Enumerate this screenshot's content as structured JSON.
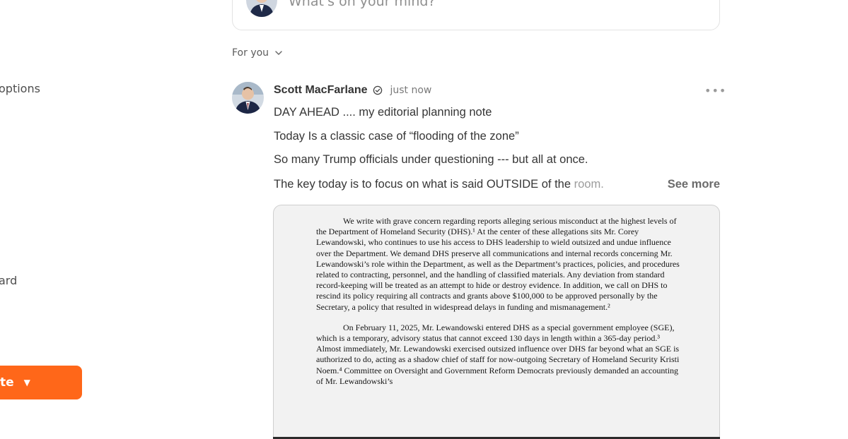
{
  "sidebar": {
    "items": [
      {
        "label": "options"
      },
      {
        "label": "ard"
      }
    ],
    "create_button": {
      "label": "te",
      "icon": "caret-down-icon",
      "color": "#ff6719"
    }
  },
  "composer": {
    "placeholder": "What's on your mind?"
  },
  "feed": {
    "selector_label": "For you",
    "selector_icon": "chevron-down-icon"
  },
  "post": {
    "author": "Scott MacFarlane",
    "verified_icon": "verified-check-icon",
    "timestamp": "just now",
    "menu_icon": "more-horizontal-icon",
    "lines": [
      "DAY AHEAD .... my editorial planning note",
      "Today Is a classic case of “flooding of the zone”",
      "So many Trump officials under questioning --- but all at once."
    ],
    "line4_main": "The key today is to focus on what is said OUTSIDE of the ",
    "line4_fade": "room.",
    "see_more": "See more",
    "attachment": {
      "paragraph1": "We write with grave concern regarding reports alleging serious misconduct at the highest levels of the Department of Homeland Security (DHS).¹ At the center of these allegations sits Mr. Corey Lewandowski, who continues to use his access to DHS leadership to wield outsized and undue influence over the Department. We demand DHS preserve all communications and internal records concerning Mr. Lewandowski’s role within the Department, as well as the Department’s practices, policies, and procedures related to contracting, personnel, and the handling of classified materials. Any deviation from standard record-keeping will be treated as an attempt to hide or destroy evidence. In addition, we call on DHS to rescind its policy requiring all contracts and grants above $100,000 to be approved personally by the Secretary, a policy that resulted in widespread delays in funding and mismanagement.²",
      "paragraph2": "On February 11, 2025, Mr. Lewandowski entered DHS as a special government employee (SGE), which is a temporary, advisory status that cannot exceed 130 days in length within a 365-day period.³ Almost immediately, Mr. Lewandowski exercised outsized influence over DHS far beyond what an SGE is authorized to do, acting as a shadow chief of staff for now-outgoing Secretary of Homeland Security Kristi Noem.⁴ Committee on Oversight and Government Reform Democrats previously demanded an accounting of Mr. Lewandowski’s"
    }
  }
}
